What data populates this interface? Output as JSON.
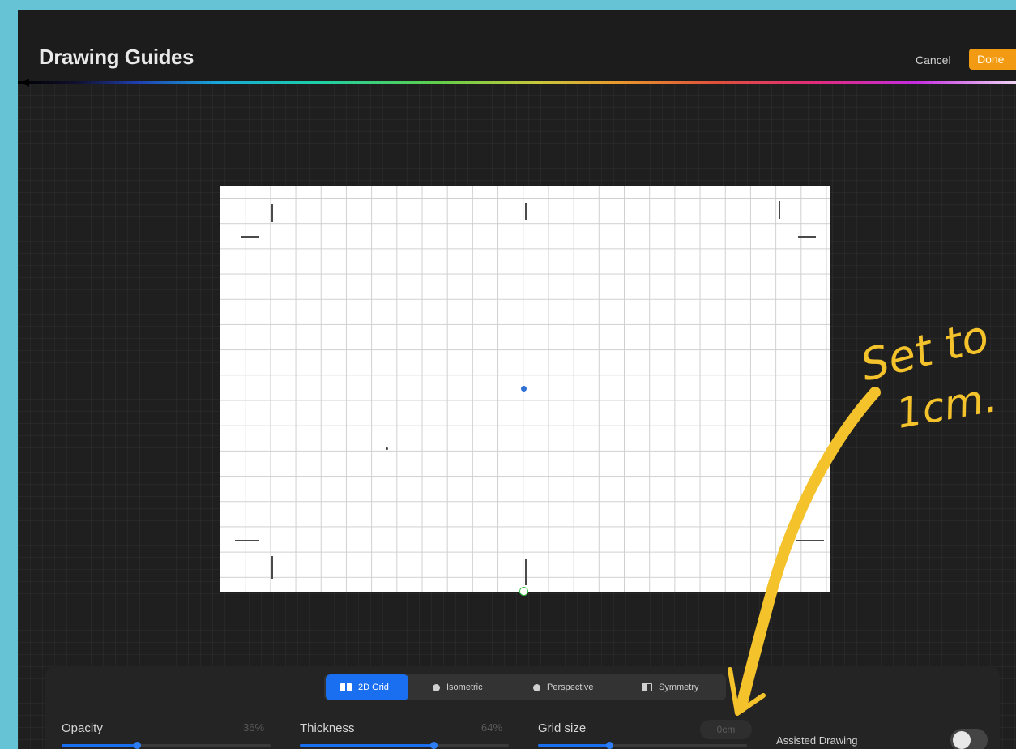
{
  "header": {
    "title": "Drawing Guides",
    "cancel_label": "Cancel",
    "done_label": "Done"
  },
  "mode_tabs": [
    {
      "label": "2D Grid",
      "icon": "grid-icon",
      "active": true
    },
    {
      "label": "Isometric",
      "icon": "isometric-icon",
      "active": false
    },
    {
      "label": "Perspective",
      "icon": "perspective-icon",
      "active": false
    },
    {
      "label": "Symmetry",
      "icon": "symmetry-icon",
      "active": false
    }
  ],
  "controls": {
    "opacity": {
      "label": "Opacity",
      "value": "36%",
      "fraction": 0.36
    },
    "thickness": {
      "label": "Thickness",
      "value": "64%",
      "fraction": 0.64
    },
    "grid_size": {
      "label": "Grid size",
      "value": "0cm",
      "fraction": 0.34
    },
    "assisted_drawing": {
      "label": "Assisted Drawing",
      "on": false
    }
  },
  "annotation": {
    "text_line1": "Set to",
    "text_line2": "1cm.",
    "color": "#f4c22b"
  },
  "colors": {
    "accent": "#1a6ef0",
    "done_button": "#f29b12",
    "background_frame": "#66c3d6"
  }
}
